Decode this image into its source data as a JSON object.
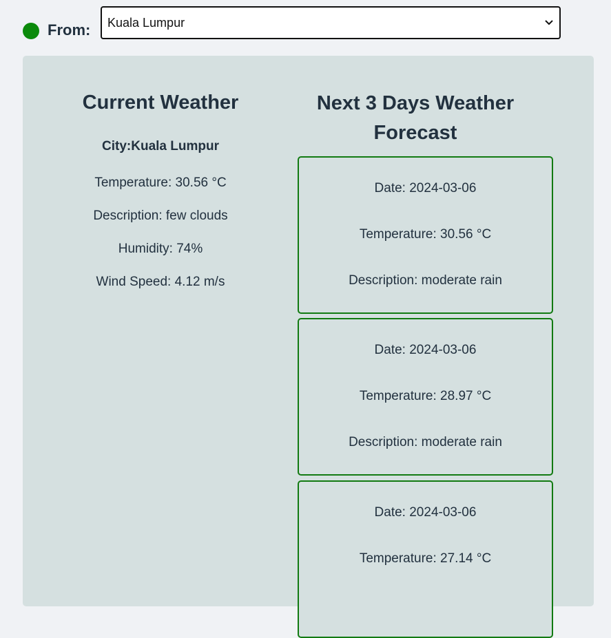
{
  "header": {
    "from_label": "From:",
    "status_color": "#0b8a0b",
    "selected_city": "Kuala Lumpur"
  },
  "current": {
    "title": "Current Weather",
    "city": "City:Kuala Lumpur",
    "temperature": "Temperature: 30.56 °C",
    "description": "Description: few clouds",
    "humidity": "Humidity: 74%",
    "wind": "Wind Speed: 4.12 m/s"
  },
  "forecast": {
    "title": "Next 3 Days Weather Forecast",
    "cards": [
      {
        "date": "Date: 2024-03-06",
        "temperature": "Temperature: 30.56 °C",
        "description": "Description: moderate rain"
      },
      {
        "date": "Date: 2024-03-06",
        "temperature": "Temperature: 28.97 °C",
        "description": "Description: moderate rain"
      },
      {
        "date": "Date: 2024-03-06",
        "temperature": "Temperature: 27.14 °C",
        "description": ""
      }
    ]
  },
  "colors": {
    "panel_bg": "#d5e0e0",
    "card_border": "#117a11",
    "text": "#22313f"
  }
}
